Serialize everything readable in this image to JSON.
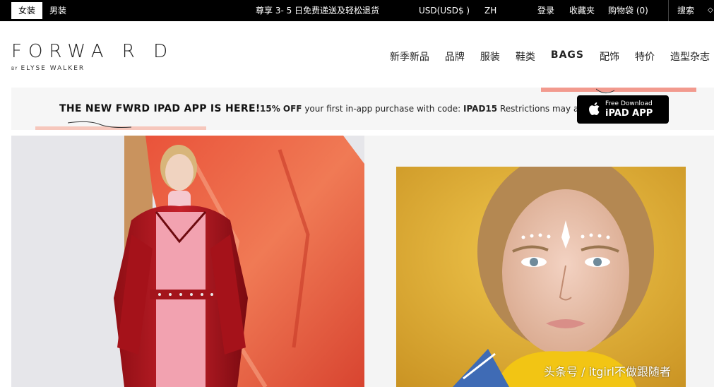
{
  "topbar": {
    "women_label": "女装",
    "men_label": "男装",
    "promo": "尊享 3- 5 日免费递送及轻松退货",
    "currency": "USD(USD$ )",
    "language": "ZH",
    "login": "登录",
    "wishlist": "收藏夹",
    "bag": "购物袋 (0)",
    "search": "搜索"
  },
  "logo": {
    "main": "FORWA R D",
    "by": "BY",
    "sub": "ELYSE WALKER"
  },
  "nav": {
    "items": [
      "新季新品",
      "品牌",
      "服装",
      "鞋类",
      "BAGS",
      "配饰",
      "特价",
      "造型杂志"
    ]
  },
  "banner": {
    "headline": "THE NEW FWRD IPAD APP IS HERE!",
    "offer_bold": "15% OFF",
    "offer_text": " your first in-app purchase with code: ",
    "offer_code": "IPAD15",
    "offer_tail": "  Restrictions may apply.",
    "app_small": "Free Download",
    "app_big": "iPAD APP"
  },
  "watermark": "头条号 / itgirl不做跟随者",
  "colors": {
    "topbar_bg": "#000000",
    "banner_bg": "#f6f6f6",
    "accent_coral": "#f29a8e"
  }
}
